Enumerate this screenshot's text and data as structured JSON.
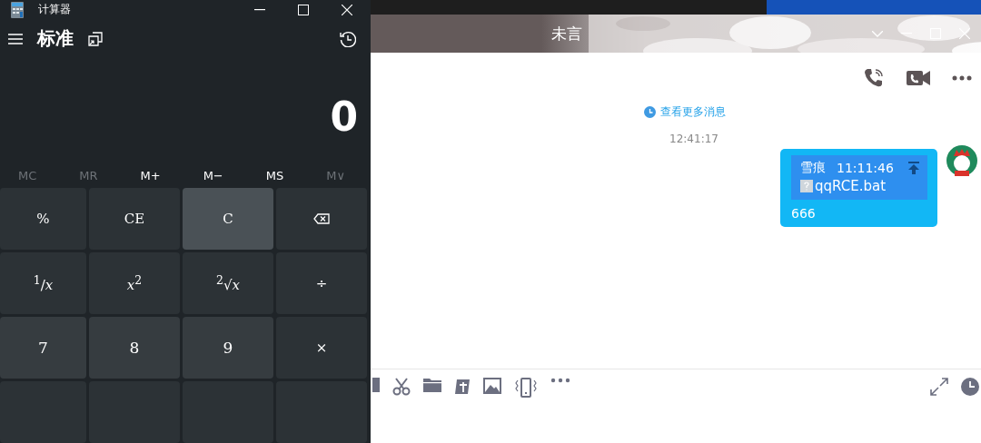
{
  "calculator": {
    "title": "计算器",
    "mode": "标准",
    "display": "0",
    "memory": [
      {
        "label": "MC",
        "disabled": true
      },
      {
        "label": "MR",
        "disabled": true
      },
      {
        "label": "M+",
        "disabled": false
      },
      {
        "label": "M−",
        "disabled": false
      },
      {
        "label": "MS",
        "disabled": false
      },
      {
        "label": "M∨",
        "disabled": true
      }
    ],
    "keys": [
      {
        "kind": "function",
        "label": "%",
        "highlighted": false
      },
      {
        "kind": "function",
        "label": "CE",
        "highlighted": false
      },
      {
        "kind": "function",
        "label": "C",
        "highlighted": true
      },
      {
        "kind": "backspace",
        "highlighted": false
      },
      {
        "kind": "function",
        "label": "$^{1}$/*x*",
        "highlighted": false
      },
      {
        "kind": "function",
        "label": "*x*$^{2}$",
        "highlighted": false
      },
      {
        "kind": "function",
        "label": "$^{2}$√*x*",
        "highlighted": false
      },
      {
        "kind": "function",
        "label": "÷",
        "highlighted": false
      },
      {
        "kind": "number",
        "label": "7",
        "highlighted": false
      },
      {
        "kind": "number",
        "label": "8",
        "highlighted": false
      },
      {
        "kind": "number",
        "label": "9",
        "highlighted": false
      },
      {
        "kind": "function",
        "label": "×",
        "highlighted": false
      },
      {
        "kind": "cut",
        "highlighted": false
      },
      {
        "kind": "cut",
        "highlighted": false
      },
      {
        "kind": "cut",
        "highlighted": false
      },
      {
        "kind": "cut",
        "highlighted": false
      }
    ]
  },
  "chat": {
    "title": "未言",
    "more_link": "查看更多消息",
    "timestamp": "12:41:17",
    "message": {
      "sender": "雪痕",
      "time": "11:11:46",
      "file": "qqRCE.bat",
      "text": "666"
    }
  }
}
